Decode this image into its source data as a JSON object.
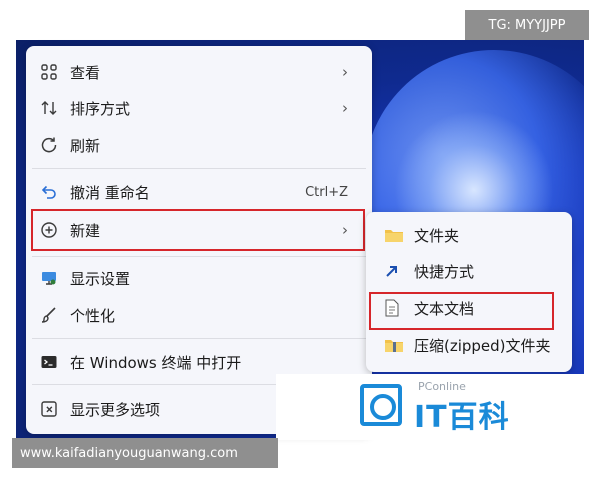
{
  "tag": "TG: MYYJJPP",
  "watermark": "www.kaifadianyouguanwang.com",
  "menu": {
    "items": [
      {
        "label": "查看",
        "icon": "grid-icon",
        "chevron": "›"
      },
      {
        "label": "排序方式",
        "icon": "sort-icon",
        "chevron": "›"
      },
      {
        "label": "刷新",
        "icon": "refresh-icon"
      },
      {
        "label": "撤消 重命名",
        "icon": "undo-icon",
        "shortcut": "Ctrl+Z"
      },
      {
        "label": "新建",
        "icon": "new-icon",
        "chevron": "›"
      },
      {
        "label": "显示设置",
        "icon": "display-icon"
      },
      {
        "label": "个性化",
        "icon": "brush-icon"
      },
      {
        "label": "在 Windows 终端 中打开",
        "icon": "terminal-icon"
      },
      {
        "label": "显示更多选项",
        "icon": "more-icon"
      }
    ]
  },
  "submenu": {
    "items": [
      {
        "label": "文件夹",
        "icon": "folder-icon"
      },
      {
        "label": "快捷方式",
        "icon": "shortcut-icon"
      },
      {
        "label": "文本文档",
        "icon": "document-icon"
      },
      {
        "label": "压缩(zipped)文件夹",
        "icon": "zip-folder-icon"
      }
    ]
  },
  "logo": {
    "small": "PConline",
    "name": "IT百科"
  },
  "colors": {
    "highlight": "#d6262b",
    "brand": "#1a8ad8"
  }
}
